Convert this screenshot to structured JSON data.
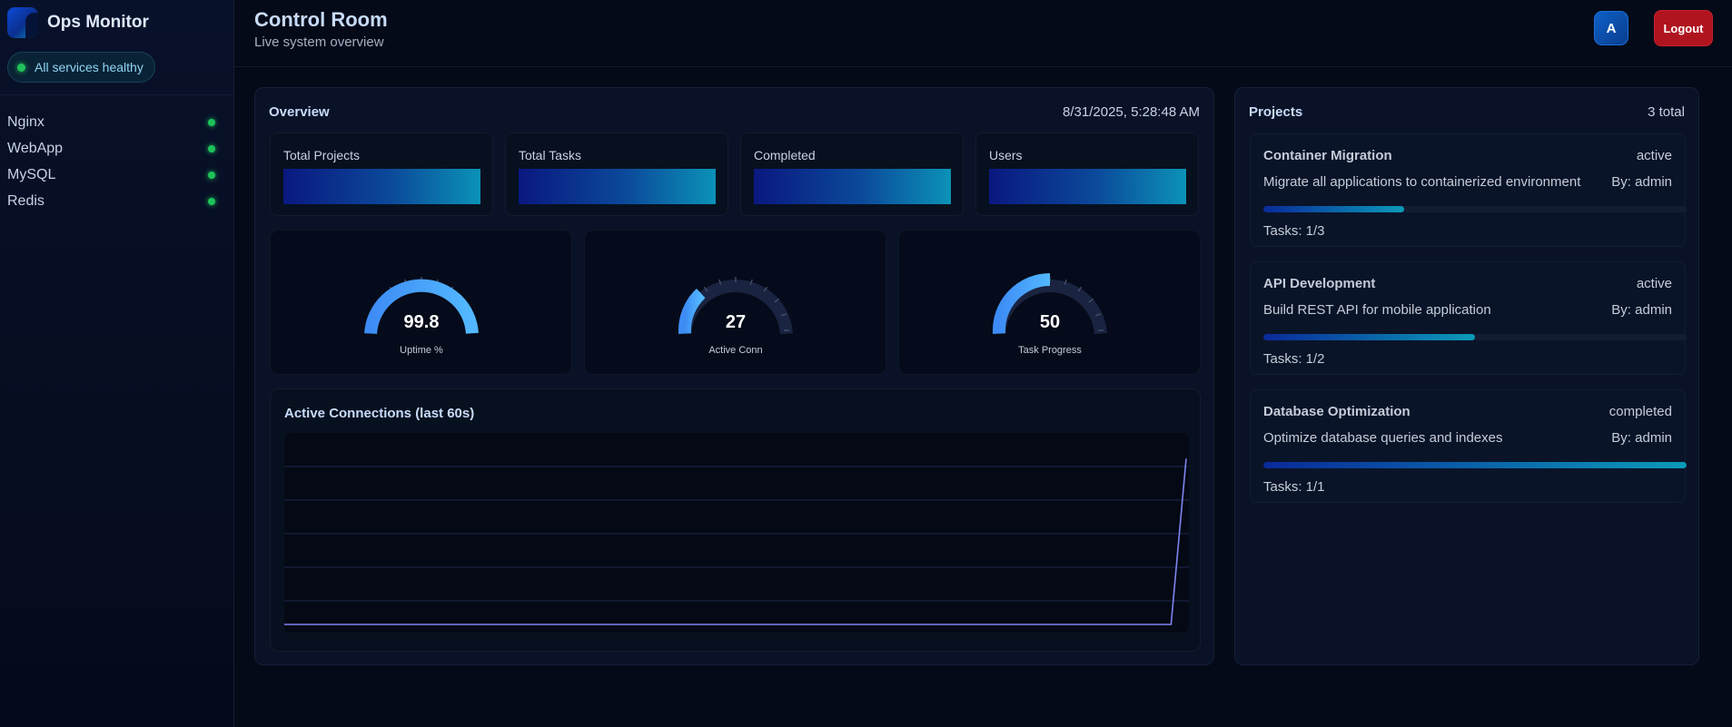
{
  "sidebar": {
    "brand": "Ops Monitor",
    "health": "All services healthy",
    "services": [
      {
        "name": "Nginx",
        "status": "healthy"
      },
      {
        "name": "WebApp",
        "status": "healthy"
      },
      {
        "name": "MySQL",
        "status": "healthy"
      },
      {
        "name": "Redis",
        "status": "healthy"
      }
    ]
  },
  "header": {
    "title": "Control Room",
    "subtitle": "Live system overview",
    "avatar_initial": "A",
    "logout_label": "Logout"
  },
  "overview": {
    "title": "Overview",
    "timestamp": "8/31/2025, 5:28:48 AM",
    "stats": [
      {
        "label": "Total Projects"
      },
      {
        "label": "Total Tasks"
      },
      {
        "label": "Completed"
      },
      {
        "label": "Users"
      }
    ],
    "gauges": [
      {
        "value": "99.8",
        "label": "Uptime %",
        "fraction": 0.998
      },
      {
        "value": "27",
        "label": "Active Conn",
        "fraction": 0.27
      },
      {
        "value": "50",
        "label": "Task Progress",
        "fraction": 0.5
      }
    ],
    "chart_title": "Active Connections (last 60s)"
  },
  "chart_data": {
    "type": "line",
    "title": "Active Connections (last 60s)",
    "xlabel": "",
    "ylabel": "",
    "grid": true,
    "series": [
      {
        "values": [
          0,
          0,
          0,
          0,
          0,
          0,
          0,
          0,
          0,
          0,
          0,
          0,
          0,
          0,
          0,
          0,
          0,
          0,
          0,
          0,
          0,
          0,
          0,
          0,
          0,
          0,
          0,
          0,
          0,
          0,
          0,
          0,
          0,
          0,
          0,
          0,
          0,
          0,
          0,
          0,
          0,
          0,
          0,
          0,
          0,
          0,
          0,
          0,
          0,
          0,
          0,
          0,
          0,
          0,
          0,
          0,
          0,
          0,
          0,
          0,
          27
        ]
      }
    ],
    "ylim": [
      0,
      30
    ]
  },
  "projects": {
    "title": "Projects",
    "count": "3 total",
    "items": [
      {
        "name": "Container Migration",
        "status": "active",
        "description": "Migrate all applications to containerized environment",
        "owner": "By: admin",
        "tasks": "Tasks: 1/3",
        "progress": 0.333
      },
      {
        "name": "API Development",
        "status": "active",
        "description": "Build REST API for mobile application",
        "owner": "By: admin",
        "tasks": "Tasks: 1/2",
        "progress": 0.5
      },
      {
        "name": "Database Optimization",
        "status": "completed",
        "description": "Optimize database queries and indexes",
        "owner": "By: admin",
        "tasks": "Tasks: 1/1",
        "progress": 1.0
      }
    ]
  },
  "colors": {
    "accent": "#4aa8ff",
    "healthy": "#1fc25a",
    "danger": "#b0141f",
    "chart_line": "#7d85f0"
  }
}
